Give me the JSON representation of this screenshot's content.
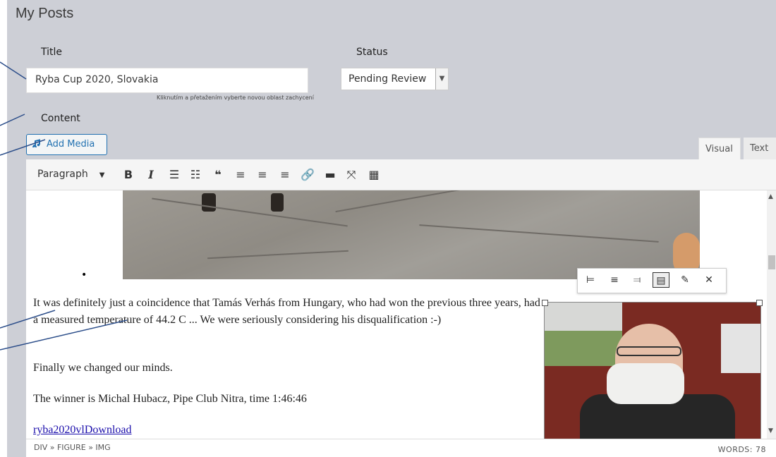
{
  "page": {
    "title": "My Posts"
  },
  "form": {
    "title_label": "Title",
    "title_value": "Ryba Cup 2020, Slovakia",
    "hint": "Kliknutím a přetažením vyberte novou oblast zachycení",
    "status_label": "Status",
    "status_value": "Pending Review",
    "content_label": "Content"
  },
  "editor": {
    "add_media": "Add Media",
    "tabs": {
      "visual": "Visual",
      "text": "Text"
    },
    "format_select": "Paragraph",
    "toolbar_icons": [
      "bold-icon",
      "italic-icon",
      "bullet-list-icon",
      "numbered-list-icon",
      "blockquote-icon",
      "align-left-icon",
      "align-center-icon",
      "align-right-icon",
      "link-icon",
      "read-more-icon",
      "fullscreen-icon",
      "toolbar-toggle-icon"
    ],
    "paragraphs": [
      "It was definitely just a coincidence that Tamás Verhás from Hungary, who had won the previous three years, had a measured temperature of 44.2 C ... We were seriously considering his disqualification :-)",
      "Finally we changed our minds.",
      "The winner is Michal Hubacz, Pipe Club Nitra, time 1:46:46"
    ],
    "link_text": "ryba2020vlDownload",
    "image_toolbar_icons": [
      "align-left-icon",
      "align-center-icon",
      "align-right-icon",
      "align-none-icon",
      "edit-icon",
      "remove-icon"
    ]
  },
  "statusbar": {
    "path": "DIV » FIGURE » IMG",
    "words": "WORDS: 78"
  },
  "colors": {
    "accent": "#2271b1",
    "background": "#cdcfd6",
    "annotation": "#2c4e8a"
  }
}
